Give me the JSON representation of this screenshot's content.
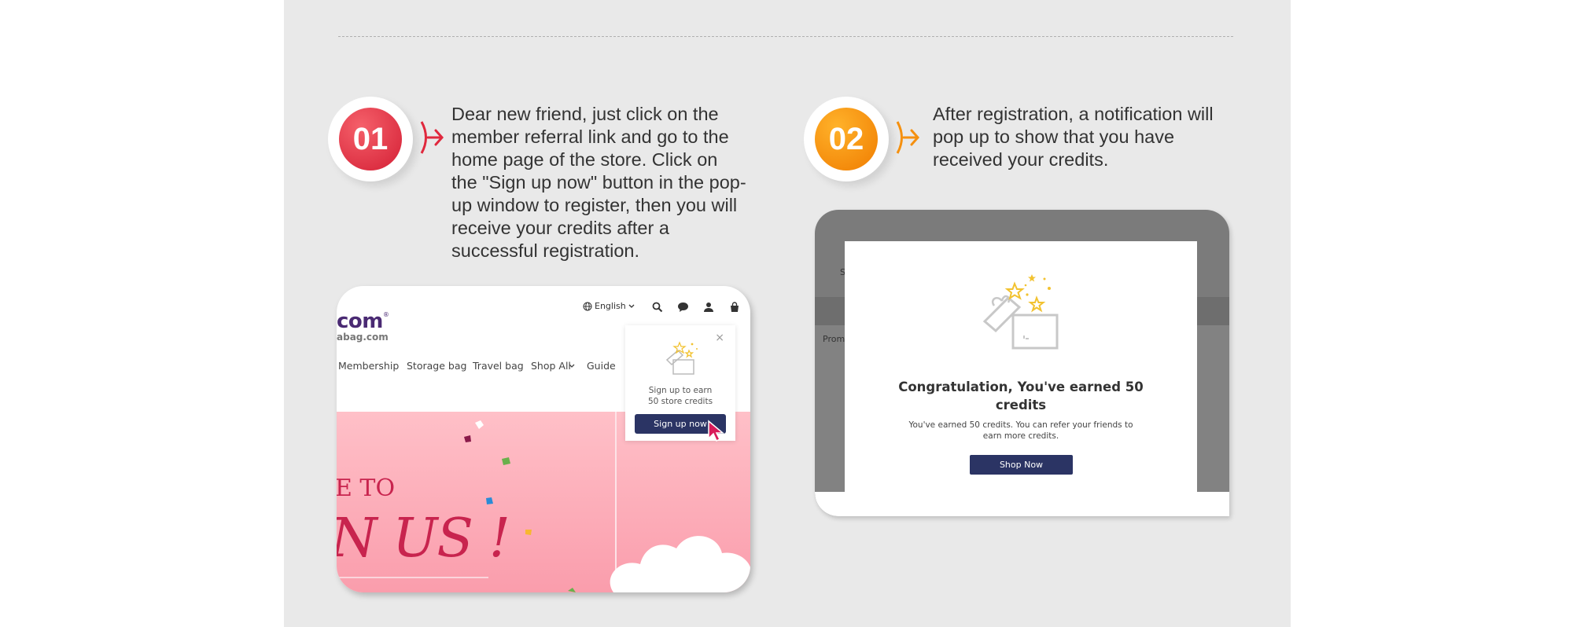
{
  "steps": [
    {
      "number": "01",
      "text": "Dear new friend, just click on the member referral link and go to the home page of the store. Click on the \"Sign up now\" button in the pop-up window to register, then you will receive your credits after a successful registration.",
      "accent_color": "#e0283d"
    },
    {
      "number": "02",
      "text": "After registration, a notification will pop up to show that you have received your credits.",
      "accent_color": "#f5900f"
    }
  ],
  "screenshot1": {
    "logo_text": "com",
    "logo_mark": "®",
    "logo_sub": "abag.com",
    "language_label": "English",
    "nav_items": [
      "Membership",
      "Storage bag",
      "Travel bag",
      "Shop All",
      "Guide"
    ],
    "hero_line1": "E TO",
    "hero_line2": "N US !",
    "popup": {
      "close": "×",
      "line1": "Sign up to earn",
      "line2": "50 store credits",
      "button": "Sign up now"
    },
    "icons": [
      "globe-icon",
      "chevron-down-icon",
      "search-icon",
      "chat-icon",
      "user-icon",
      "bag-icon",
      "cursor-icon",
      "gift-box-icon"
    ]
  },
  "screenshot2": {
    "bg_text_1": "S",
    "bg_text_2": "Prom",
    "title": "Congratulation, You've earned 50 credits",
    "message": "You've earned 50 credits. You can refer your friends to earn more credits.",
    "button": "Shop Now",
    "icons": [
      "gift-box-icon"
    ]
  }
}
